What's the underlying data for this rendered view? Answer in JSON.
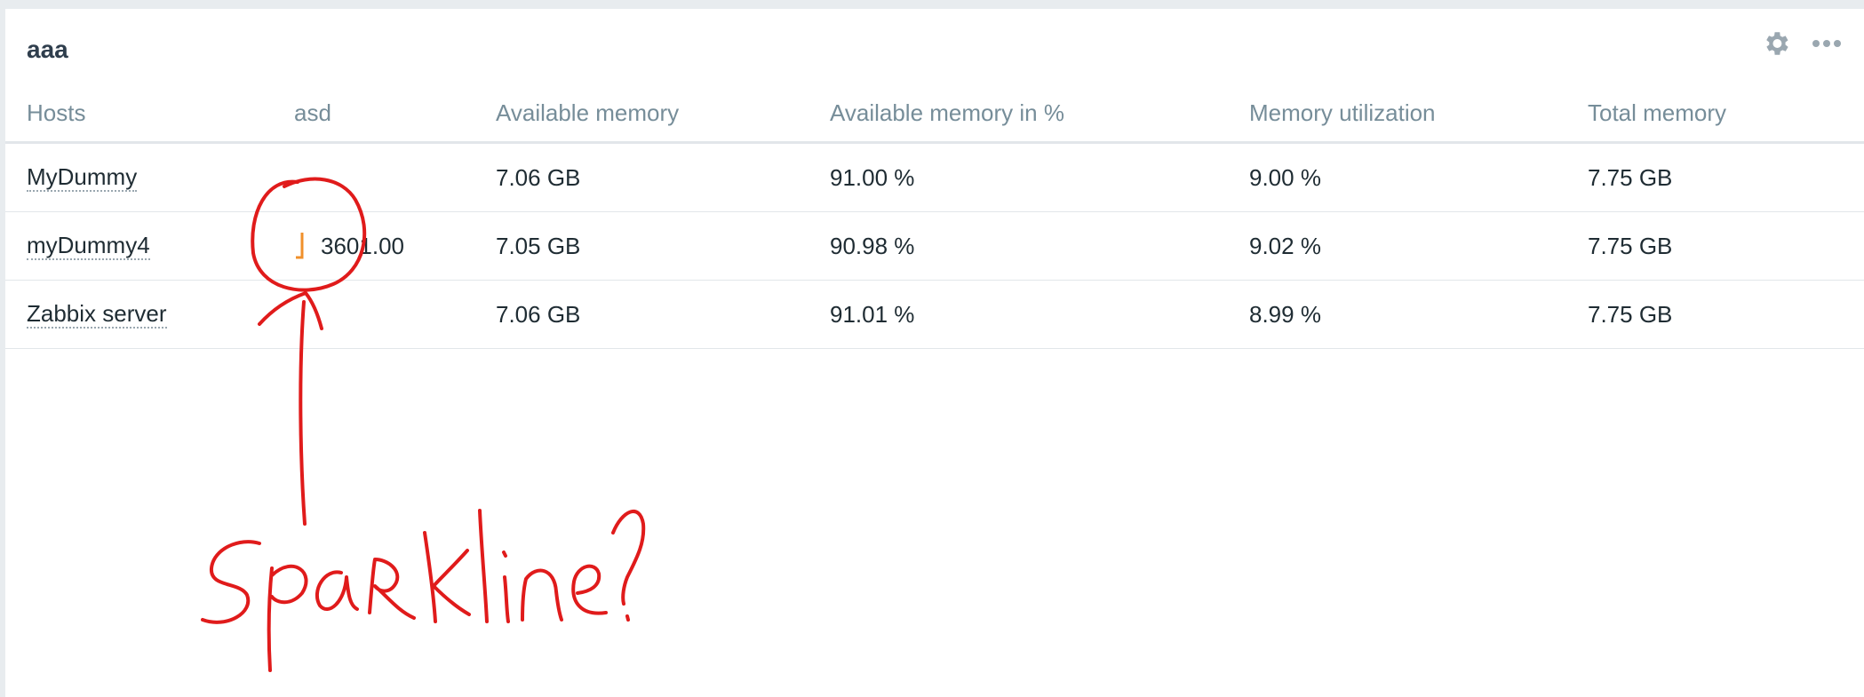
{
  "widget": {
    "title": "aaa",
    "icons": [
      "gear-icon",
      "more-icon"
    ]
  },
  "table": {
    "columns": [
      "Hosts",
      "asd",
      "Available memory",
      "Available memory in %",
      "Memory utilization",
      "Total memory"
    ],
    "rows": [
      {
        "host": "MyDummy",
        "asd": "",
        "available_memory": "7.06 GB",
        "available_percent": "91.00 %",
        "utilization": "9.00 %",
        "total": "7.75 GB"
      },
      {
        "host": "myDummy4",
        "asd": "3601.00",
        "available_memory": "7.05 GB",
        "available_percent": "90.98 %",
        "utilization": "9.02 %",
        "total": "7.75 GB"
      },
      {
        "host": "Zabbix server",
        "asd": "",
        "available_memory": "7.06 GB",
        "available_percent": "91.01 %",
        "utilization": "8.99 %",
        "total": "7.75 GB"
      }
    ]
  },
  "colors": {
    "sparkline": "#f0902b",
    "annotation": "#e01b1b",
    "header_text": "#768d99",
    "body_text": "#1f2c33"
  },
  "annotation": {
    "handwritten_text": "Sparkline?"
  }
}
